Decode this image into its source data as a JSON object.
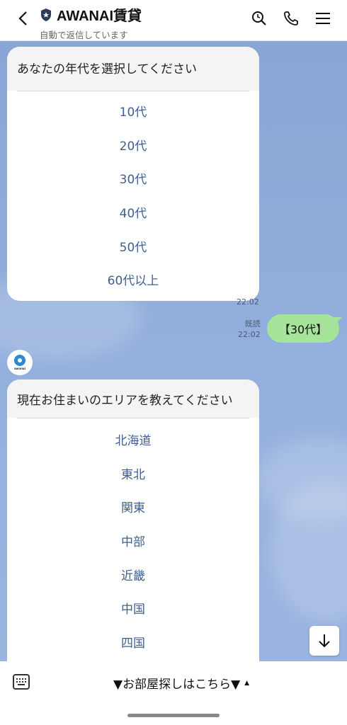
{
  "header": {
    "title": "AWANAI賃貸",
    "subtitle": "自動で返信しています",
    "icons": [
      "back-icon",
      "shield-icon",
      "search-icon",
      "phone-icon",
      "menu-icon"
    ]
  },
  "chat": {
    "card1": {
      "question": "あなたの年代を選択してください",
      "options": [
        "10代",
        "20代",
        "30代",
        "40代",
        "50代",
        "60代以上"
      ],
      "time": "22:02"
    },
    "user_msg": {
      "text": "【30代】",
      "read": "既読",
      "time": "22:02"
    },
    "card2": {
      "question": "現在お住まいのエリアを教えてください",
      "options": [
        "北海道",
        "東北",
        "関東",
        "中部",
        "近畿",
        "中国",
        "四国"
      ]
    }
  },
  "bottom": {
    "rich_menu_label": "▼お部屋探しはこちら▼",
    "caret": "▲"
  },
  "colors": {
    "chat_bg": "#8aa6d6",
    "user_bubble": "#a6e39b",
    "option_text": "#3f5f8f"
  }
}
